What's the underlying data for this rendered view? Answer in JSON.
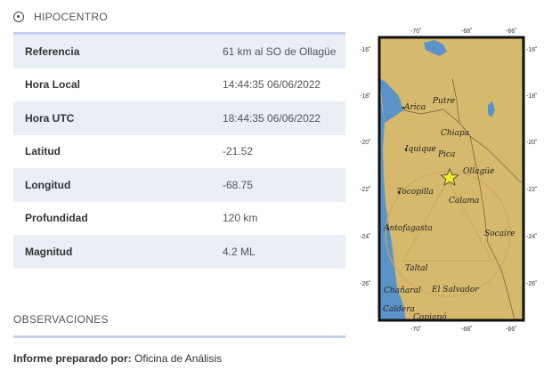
{
  "hipocentro": {
    "title": "HIPOCENTRO",
    "rows": [
      {
        "label": "Referencia",
        "value": "61 km al SO de Ollagüe"
      },
      {
        "label": "Hora Local",
        "value": "14:44:35 06/06/2022"
      },
      {
        "label": "Hora UTC",
        "value": "18:44:35 06/06/2022"
      },
      {
        "label": "Latitud",
        "value": "-21.52"
      },
      {
        "label": "Longitud",
        "value": "-68.75"
      },
      {
        "label": "Profundidad",
        "value": "120 km"
      },
      {
        "label": "Magnitud",
        "value": "4.2 ML"
      }
    ]
  },
  "observaciones": {
    "title": "OBSERVACIONES"
  },
  "footer": {
    "label": "Informe preparado por:",
    "value": "Oficina de Análisis"
  },
  "map": {
    "lon_ticks": [
      "-70˚",
      "-68˚",
      "-66˚"
    ],
    "lat_ticks": [
      "-16˚",
      "-18˚",
      "-20˚",
      "-22˚",
      "-24˚",
      "-26˚"
    ],
    "places": [
      "Arica",
      "Putre",
      "Chiapa",
      "Iquique",
      "Pica",
      "Ollagüe",
      "Tocopilla",
      "Calama",
      "Antofagasta",
      "Socaire",
      "Taltal",
      "Chañaral",
      "El Salvador",
      "Caldera",
      "Copiapó"
    ],
    "colors": {
      "ocean": "#5b93c9",
      "land": "#d7b96d",
      "star": "#f3ec2e",
      "accent_line": "#c3d0ea"
    }
  }
}
